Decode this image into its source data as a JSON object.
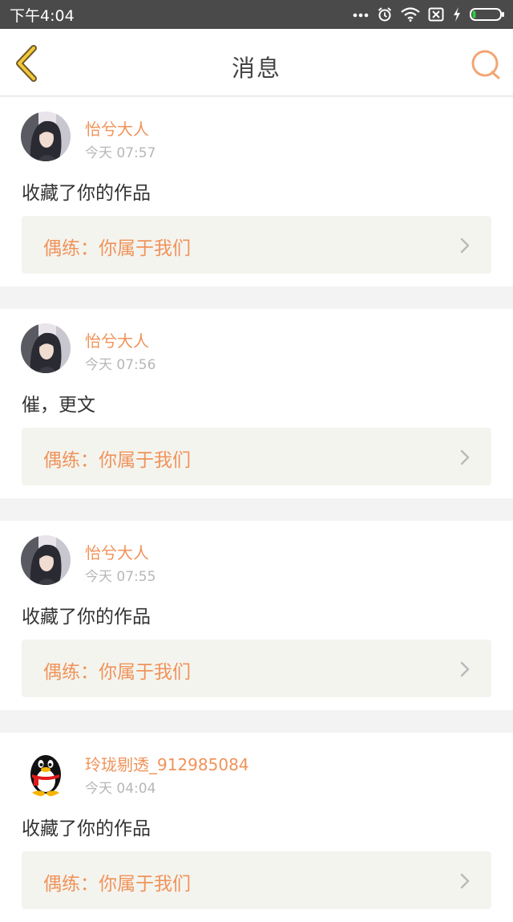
{
  "status_bar": {
    "time": "下午4:04",
    "icons": [
      "more-dots-icon",
      "alarm-icon",
      "wifi-icon",
      "no-sim-icon",
      "charging-icon",
      "battery-icon"
    ]
  },
  "header": {
    "title": "消息",
    "back_icon": "back-chevron-icon",
    "search_icon": "search-icon",
    "accent_color": "#f0935a"
  },
  "messages": [
    {
      "user": "怡兮大人",
      "time": "今天 07:57",
      "action": "收藏了你的作品",
      "work": "偶练：你属于我们",
      "avatar": "photo-avatar"
    },
    {
      "user": "怡兮大人",
      "time": "今天 07:56",
      "action": "催，更文",
      "work": "偶练：你属于我们",
      "avatar": "photo-avatar"
    },
    {
      "user": "怡兮大人",
      "time": "今天 07:55",
      "action": "收藏了你的作品",
      "work": "偶练：你属于我们",
      "avatar": "photo-avatar"
    },
    {
      "user": "玲珑剔透_912985084",
      "time": "今天 04:04",
      "action": "收藏了你的作品",
      "work": "偶练：你属于我们",
      "avatar": "penguin-avatar"
    }
  ]
}
